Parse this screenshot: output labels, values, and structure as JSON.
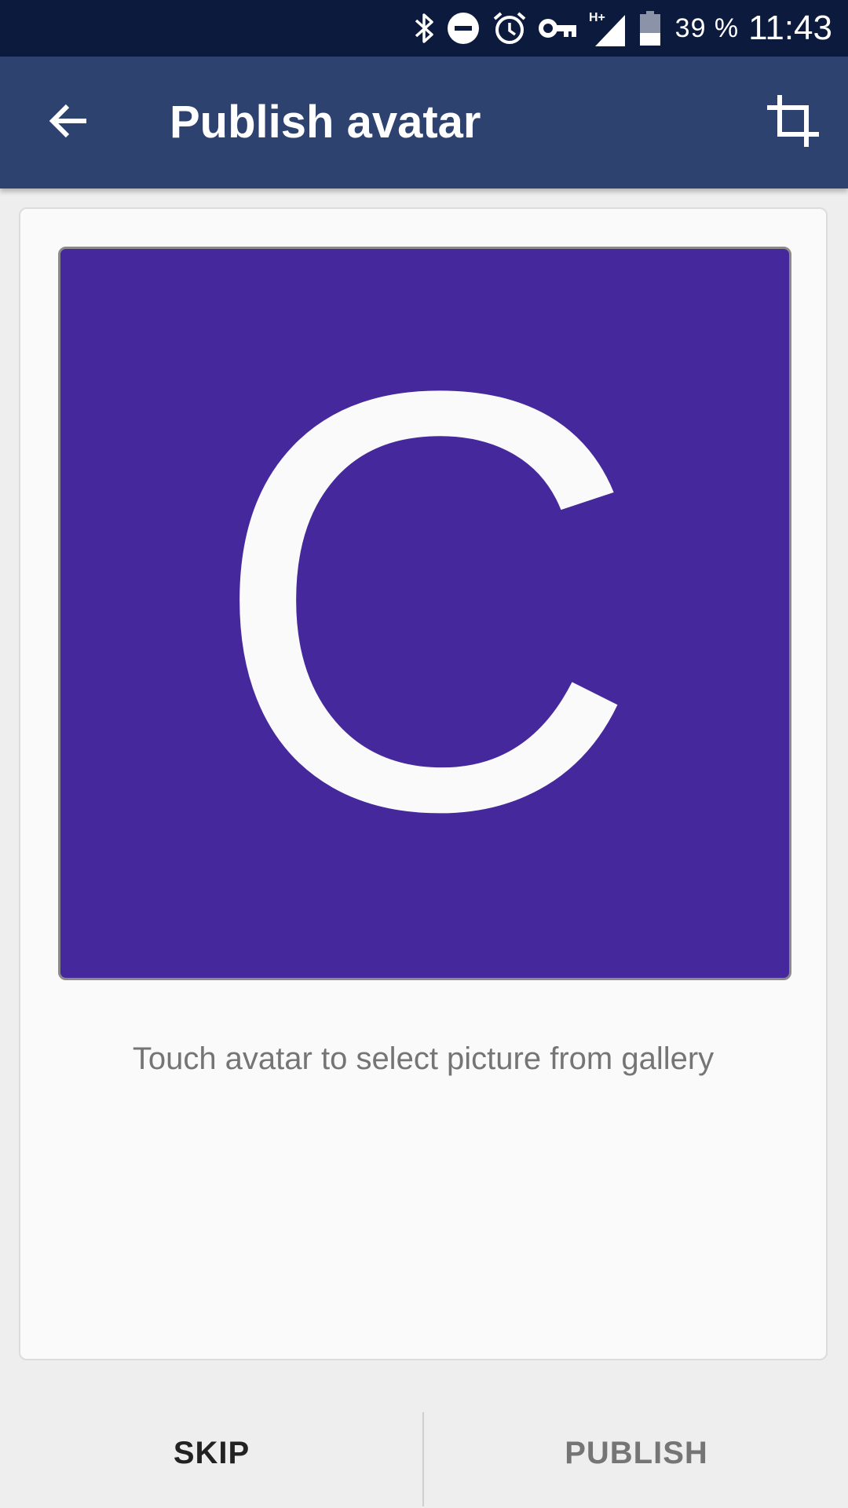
{
  "status_bar": {
    "icons": [
      "bluetooth-icon",
      "do-not-disturb-icon",
      "alarm-icon",
      "vpn-key-icon",
      "signal-h-plus-icon",
      "battery-icon"
    ],
    "network_type": "H+",
    "battery_percent": "39 %",
    "time": "11:43"
  },
  "app_bar": {
    "back_icon": "arrow-back-icon",
    "title": "Publish avatar",
    "action_icon": "crop-icon",
    "background": "#2e4270"
  },
  "avatar": {
    "letter": "C",
    "background": "#45289c"
  },
  "hint": "Touch avatar to select picture from gallery",
  "actions": {
    "skip_label": "SKIP",
    "publish_label": "PUBLISH"
  }
}
